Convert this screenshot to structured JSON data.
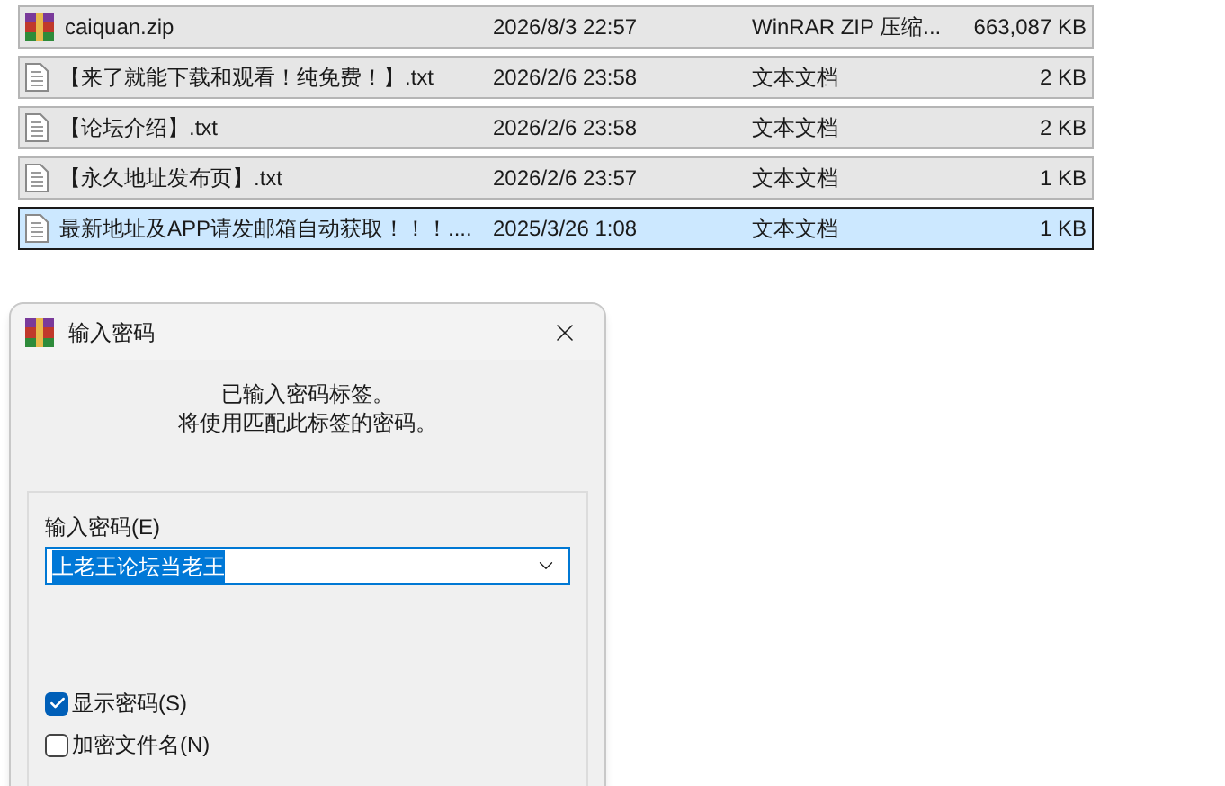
{
  "files": [
    {
      "name": "caiquan.zip",
      "kind": "archive",
      "modified": "2026/8/3 22:57",
      "type": "WinRAR ZIP 压缩...",
      "size": "663,087 KB",
      "selected": false
    },
    {
      "name": "【来了就能下载和观看！纯免费！】.txt",
      "kind": "text",
      "modified": "2026/2/6 23:58",
      "type": "文本文档",
      "size": "2 KB",
      "selected": false
    },
    {
      "name": "【论坛介绍】.txt",
      "kind": "text",
      "modified": "2026/2/6 23:58",
      "type": "文本文档",
      "size": "2 KB",
      "selected": false
    },
    {
      "name": "【永久地址发布页】.txt",
      "kind": "text",
      "modified": "2026/2/6 23:57",
      "type": "文本文档",
      "size": "1 KB",
      "selected": false
    },
    {
      "name": "最新地址及APP请发邮箱自动获取！！！....",
      "kind": "text",
      "modified": "2025/3/26 1:08",
      "type": "文本文档",
      "size": "1 KB",
      "selected": true
    }
  ],
  "dialog": {
    "title": "输入密码",
    "message": [
      "已输入密码标签。",
      "将使用匹配此标签的密码。"
    ],
    "password_label": "输入密码(E)",
    "password_value": "上老王论坛当老王",
    "password_text_selected": true,
    "options": [
      {
        "label": "显示密码(S)",
        "checked": true
      },
      {
        "label": "加密文件名(N)",
        "checked": false
      }
    ]
  }
}
